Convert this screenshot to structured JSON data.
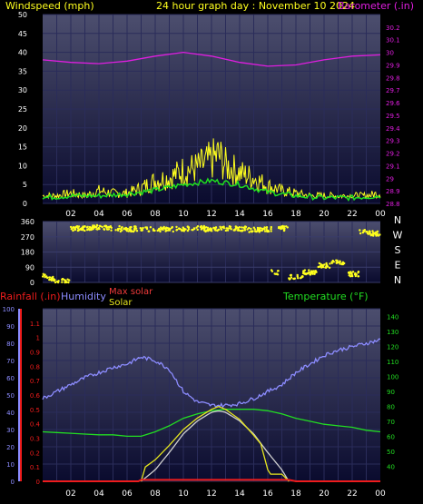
{
  "header": {
    "windspeed_label": "Windspeed (mph)",
    "title": "24 hour graph day : November 10 2024",
    "barometer_label": "Barometer (.in)"
  },
  "bottom_legend": {
    "rainfall_label": "Rainfall (.in)",
    "humidity_label": "Humidity",
    "max_solar_label": "Max solar",
    "solar_label": "Solar",
    "temperature_label": "Temperature (°F)"
  },
  "colors": {
    "panel_top": "#4c4e6e",
    "panel_bottom": "#0a0b2e",
    "wind": "#ffff1e",
    "wind_avg": "#1fdf1f",
    "barometer": "#e01ee0",
    "direction": "#ffff1e",
    "rain": "#ee1c1c",
    "humidity": "#8c8cff",
    "max_solar": "#cfcfcf",
    "solar": "#e6e61e",
    "temperature": "#22dd22",
    "axis_cyan": "#22cccc",
    "axis_white": "#ffffff"
  },
  "chart_data": [
    {
      "type": "line",
      "title": "24 hour graph day : November 10 2024",
      "ylabel": "Windspeed (mph)",
      "y2label": "Barometer (.in)",
      "ylim": [
        0,
        50
      ],
      "y2lim": [
        28.8,
        30.3
      ],
      "y_ticks": [
        0,
        5,
        10,
        15,
        20,
        25,
        30,
        35,
        40,
        45,
        50
      ],
      "y2_ticks": [
        "28.8",
        "28.9",
        "29",
        "29.1",
        "29.2",
        "29.3",
        "29.4",
        "29.5",
        "29.6",
        "29.7",
        "29.8",
        "29.9",
        "30",
        "30.1",
        "30.2"
      ],
      "x_ticks": [
        "02",
        "04",
        "06",
        "08",
        "10",
        "12",
        "14",
        "16",
        "18",
        "20",
        "22",
        "00"
      ],
      "xlim": [
        0,
        24
      ],
      "series": [
        {
          "name": "Windspeed (mph)",
          "x": [
            0,
            1,
            2,
            3,
            4,
            5,
            6,
            7,
            8,
            9,
            10,
            11,
            12,
            12.5,
            13,
            14,
            15,
            16,
            17,
            18,
            19,
            20,
            21,
            22,
            23,
            24
          ],
          "y": [
            3,
            3,
            4,
            3,
            5,
            4,
            4,
            6,
            9,
            10,
            13,
            14,
            17,
            19,
            15,
            12,
            10,
            7,
            5,
            4,
            3,
            3,
            3,
            3,
            3,
            4
          ]
        },
        {
          "name": "Wind avg",
          "x": [
            0,
            2,
            4,
            6,
            8,
            10,
            12,
            14,
            16,
            18,
            20,
            22,
            24
          ],
          "y": [
            1.5,
            2,
            2,
            2.5,
            3.5,
            5,
            6,
            5,
            3,
            2,
            1.5,
            1.5,
            2
          ]
        },
        {
          "name": "Barometer (.in)",
          "x": [
            0,
            2,
            4,
            6,
            8,
            10,
            12,
            14,
            16,
            18,
            20,
            22,
            24
          ],
          "y": [
            29.94,
            29.92,
            29.91,
            29.93,
            29.97,
            30.0,
            29.97,
            29.92,
            29.89,
            29.9,
            29.94,
            29.97,
            29.98
          ]
        }
      ]
    },
    {
      "type": "scatter",
      "title": "",
      "ylim": [
        0,
        360
      ],
      "y_ticks": [
        0,
        90,
        180,
        270,
        360
      ],
      "compass_labels": [
        "N",
        "W",
        "S",
        "E",
        "N"
      ],
      "xlim": [
        0,
        24
      ],
      "series": [
        {
          "name": "Wind direction",
          "x": [
            0.2,
            0.6,
            1.0,
            3.0,
            4.0,
            5.0,
            6.0,
            7.0,
            8.0,
            9.0,
            10.0,
            11.0,
            12.0,
            13.0,
            14.0,
            15.0,
            16.0,
            16.5,
            17.0,
            18.0,
            19.0,
            20.0,
            21.0,
            22.0,
            23.0,
            23.5
          ],
          "y": [
            40,
            20,
            10,
            320,
            325,
            320,
            315,
            318,
            315,
            315,
            318,
            320,
            315,
            320,
            318,
            310,
            315,
            60,
            320,
            30,
            60,
            100,
            120,
            50,
            300,
            290
          ]
        }
      ]
    },
    {
      "type": "line",
      "title": "",
      "ylabel": "Humidity",
      "y2label": "Temperature (°F)",
      "ylim": [
        0,
        100
      ],
      "rain_ylim": [
        0,
        1.2
      ],
      "y2lim": [
        30,
        145
      ],
      "y_ticks": [
        0,
        10,
        20,
        30,
        40,
        50,
        60,
        70,
        80,
        90,
        100
      ],
      "rain_ticks": [
        "0",
        "0.1",
        "0.2",
        "0.3",
        "0.4",
        "0.5",
        "0.6",
        "0.7",
        "0.8",
        "0.9",
        "1",
        "1.1"
      ],
      "y2_ticks": [
        40,
        50,
        60,
        70,
        80,
        90,
        100,
        110,
        120,
        130,
        140
      ],
      "x_ticks": [
        "02",
        "04",
        "06",
        "08",
        "10",
        "12",
        "14",
        "16",
        "18",
        "20",
        "22",
        "00"
      ],
      "xlim": [
        0,
        24
      ],
      "series": [
        {
          "name": "Humidity",
          "x": [
            0,
            1,
            2,
            3,
            4,
            5,
            6,
            7,
            8,
            9,
            10,
            11,
            12,
            13,
            14,
            15,
            16,
            17,
            18,
            19,
            20,
            21,
            22,
            23,
            24
          ],
          "y": [
            48,
            52,
            56,
            60,
            63,
            66,
            68,
            72,
            70,
            65,
            52,
            46,
            44,
            44,
            45,
            48,
            52,
            56,
            63,
            68,
            73,
            76,
            78,
            80,
            82
          ]
        },
        {
          "name": "Temperature (°F)",
          "x": [
            0,
            1,
            2,
            3,
            4,
            5,
            6,
            7,
            8,
            9,
            10,
            11,
            12,
            13,
            14,
            15,
            16,
            17,
            18,
            19,
            20,
            21,
            22,
            23,
            24
          ],
          "y": [
            63,
            62.5,
            62,
            61.5,
            61,
            61,
            60,
            60,
            63,
            67,
            72,
            75,
            77,
            78,
            78,
            78,
            77,
            75,
            72,
            70,
            68,
            67,
            66,
            64,
            63
          ]
        },
        {
          "name": "Max solar",
          "x": [
            7,
            8,
            9,
            10,
            11,
            12,
            12.5,
            13,
            14,
            15,
            16,
            17,
            17.5
          ],
          "y": [
            0,
            0.08,
            0.2,
            0.33,
            0.42,
            0.48,
            0.49,
            0.48,
            0.42,
            0.33,
            0.2,
            0.08,
            0
          ]
        },
        {
          "name": "Solar",
          "x": [
            7,
            7.3,
            8,
            9,
            10,
            11,
            12,
            12.5,
            13,
            14,
            15,
            15.5,
            16,
            16.2,
            17,
            17.5
          ],
          "y": [
            0,
            0.1,
            0.15,
            0.25,
            0.36,
            0.44,
            0.5,
            0.52,
            0.5,
            0.43,
            0.32,
            0.26,
            0.08,
            0.05,
            0.05,
            0
          ]
        },
        {
          "name": "Rainfall (.in)",
          "x": [
            0,
            6.8,
            7,
            17.5,
            18,
            24
          ],
          "y": [
            0,
            0,
            0.01,
            0.01,
            0,
            0
          ]
        }
      ]
    }
  ]
}
